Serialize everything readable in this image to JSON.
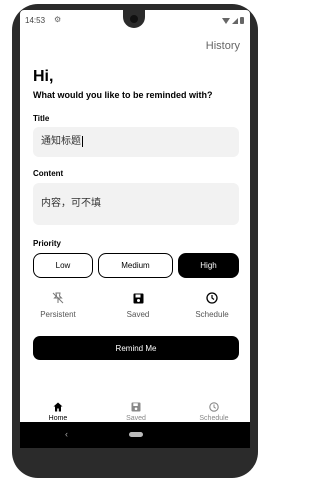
{
  "status_bar": {
    "time": "14:53"
  },
  "header": {
    "history_label": "History"
  },
  "greeting": {
    "hello": "Hi,",
    "question": "What would you like to be reminded with?"
  },
  "form": {
    "title_label": "Title",
    "title_value": "通知标题",
    "content_label": "Content",
    "content_value": "内容，可不填",
    "priority_label": "Priority",
    "priority_options": [
      "Low",
      "Medium",
      "High"
    ],
    "priority_selected": "High"
  },
  "options": {
    "persistent_label": "Persistent",
    "saved_label": "Saved",
    "schedule_label": "Schedule"
  },
  "action": {
    "remind_label": "Remind Me"
  },
  "bottom_nav": {
    "items": [
      {
        "label": "Home",
        "icon": "home-icon",
        "active": true
      },
      {
        "label": "Saved",
        "icon": "save-icon",
        "active": false
      },
      {
        "label": "Schedule",
        "icon": "clock-icon",
        "active": false
      }
    ]
  },
  "colors": {
    "accent": "#000000",
    "field_bg": "#f2f2f2",
    "inactive": "#888888"
  }
}
